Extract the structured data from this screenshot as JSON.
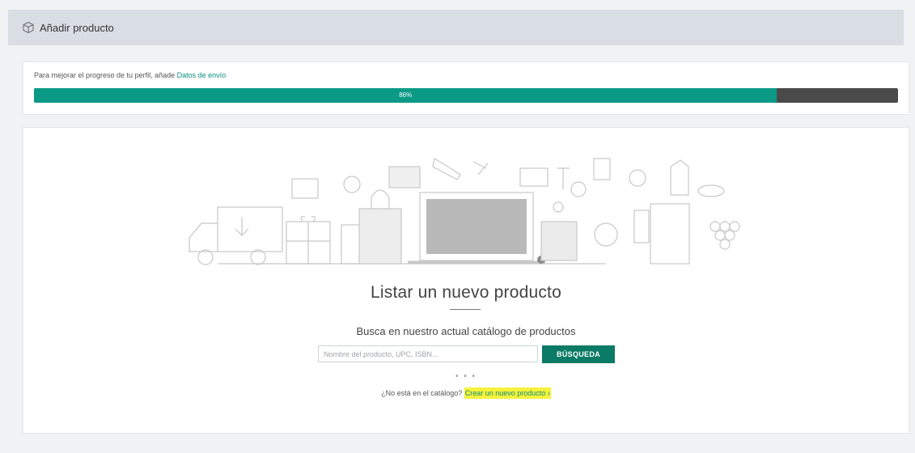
{
  "header": {
    "title": "Añadir producto",
    "icon": "box-icon"
  },
  "profile_progress": {
    "message_prefix": "Para mejorar el progreso de tu perfil, añade ",
    "message_link": "Datos de envío",
    "percent_label": "86%",
    "percent": 86,
    "fill_color": "#0a9a86",
    "track_color": "#4a4a4a"
  },
  "listing": {
    "heading": "Listar un nuevo producto",
    "subheading": "Busca en nuestro actual catálogo de productos",
    "search": {
      "placeholder": "Nombre del producto, UPC, ISBN...",
      "value": "",
      "button_label": "BÚSQUEDA"
    },
    "dots": "• • •",
    "not_in_catalog_text": "¿No está en el catálogo? ",
    "create_link_label": "Crear un nuevo producto",
    "create_link_chevron": "›"
  },
  "colors": {
    "accent": "#0b7a66",
    "highlight": "#f6f23a"
  }
}
